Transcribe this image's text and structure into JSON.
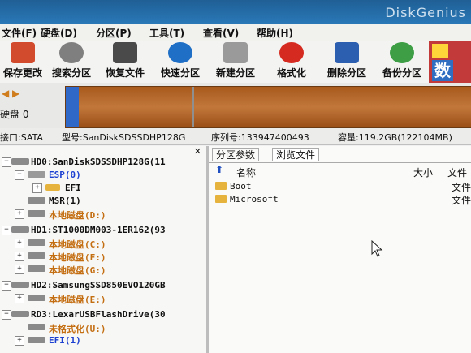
{
  "window": {
    "title": "DiskGenius"
  },
  "menu": [
    "文件(F)",
    "硬盘(D)",
    "分区(P)",
    "工具(T)",
    "查看(V)",
    "帮助(H)"
  ],
  "toolbar": [
    {
      "label": "保存更改",
      "icon": "save-icon",
      "color": "#d14b2c"
    },
    {
      "label": "搜索分区",
      "icon": "magnifier-icon",
      "color": "#7f7f7f"
    },
    {
      "label": "恢复文件",
      "icon": "restore-icon",
      "color": "#4a4a4a"
    },
    {
      "label": "快速分区",
      "icon": "quick-partition-icon",
      "color": "#1f6fc6"
    },
    {
      "label": "新建分区",
      "icon": "new-partition-icon",
      "color": "#9a9a9a"
    },
    {
      "label": "格式化",
      "icon": "format-icon",
      "color": "#d52a1f"
    },
    {
      "label": "删除分区",
      "icon": "delete-partition-icon",
      "color": "#2d5fb0"
    },
    {
      "label": "备份分区",
      "icon": "backup-partition-icon",
      "color": "#3d9e45"
    }
  ],
  "diskbar": {
    "nav": "◀ ▶",
    "disk_label": "硬盘 0"
  },
  "info": {
    "interface": "接口:SATA",
    "model": "型号:SanDiskSDSSDHP128G",
    "serial": "序列号:133947400493",
    "capacity": "容量:119.2GB(122104MB)"
  },
  "tree": [
    {
      "text": "HD0:SanDiskSDSSDHP128G(11",
      "color": "#111111"
    },
    {
      "text": "ESP(0)",
      "color": "#1b3fd1"
    },
    {
      "text": "EFI",
      "color": "#111111"
    },
    {
      "text": "MSR(1)",
      "color": "#111111"
    },
    {
      "text": "本地磁盘(D:)",
      "color": "#c46e12"
    },
    {
      "text": "HD1:ST1000DM003-1ER162(93",
      "color": "#111111"
    },
    {
      "text": "本地磁盘(C:)",
      "color": "#c46e12"
    },
    {
      "text": "本地磁盘(F:)",
      "color": "#c46e12"
    },
    {
      "text": "本地磁盘(G:)",
      "color": "#c46e12"
    },
    {
      "text": "HD2:SamsungSSD850EVO120GB",
      "color": "#111111"
    },
    {
      "text": "本地磁盘(E:)",
      "color": "#c46e12"
    },
    {
      "text": "RD3:LexarUSBFlashDrive(30",
      "color": "#111111"
    },
    {
      "text": "未格式化(U:)",
      "color": "#c46e12"
    },
    {
      "text": "EFI(1)",
      "color": "#1b3fd1"
    }
  ],
  "tabs": [
    "分区参数",
    "浏览文件"
  ],
  "file_header": {
    "name": "名称",
    "size": "大小",
    "type": "文件"
  },
  "files": [
    {
      "name": "Boot",
      "type": "文件"
    },
    {
      "name": "Microsoft",
      "type": "文件"
    }
  ]
}
